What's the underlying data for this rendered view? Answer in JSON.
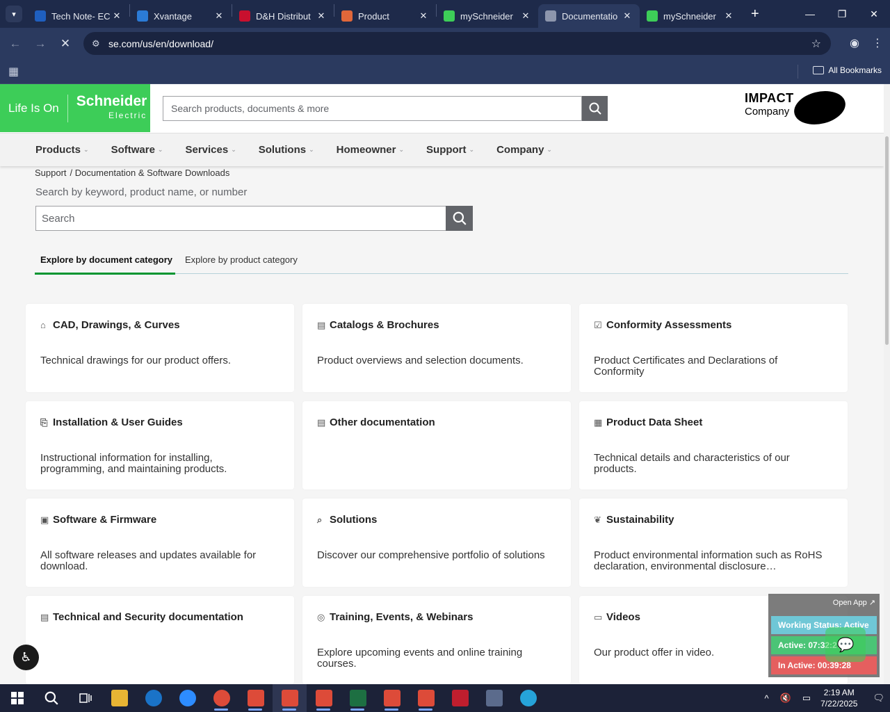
{
  "browser": {
    "tabs": [
      {
        "title": "Tech Note- EC",
        "icon": "ec-favicon",
        "color": "#1f5fbf",
        "active": false
      },
      {
        "title": "Xvantage",
        "icon": "xvantage-favicon",
        "color": "#2b7bd6",
        "active": false
      },
      {
        "title": "D&H Distribut",
        "icon": "dh-favicon",
        "color": "#c8102e",
        "active": false
      },
      {
        "title": "Product",
        "icon": "product-favicon",
        "color": "#e0673a",
        "active": false
      },
      {
        "title": "mySchneider",
        "icon": "schneider-favicon",
        "color": "#3dcd58",
        "active": false
      },
      {
        "title": "Documentatio",
        "icon": "loading-favicon",
        "color": "#8d96ad",
        "active": true
      },
      {
        "title": "mySchneider",
        "icon": "schneider-favicon",
        "color": "#3dcd58",
        "active": false
      }
    ],
    "url": "se.com/us/en/download/",
    "all_bookmarks": "All Bookmarks"
  },
  "site": {
    "logo_lifeison": "Life Is On",
    "logo_brand": "Schneider",
    "logo_sub": "Electric",
    "search_placeholder": "Search products, documents & more",
    "impact_line1": "IMPACT",
    "impact_line2": "Company",
    "nav": [
      "Products",
      "Software",
      "Services",
      "Solutions",
      "Homeowner",
      "Support",
      "Company"
    ]
  },
  "breadcrumb": [
    "Support",
    "/ Documentation & Software Downloads"
  ],
  "search_prompt": "Search by keyword, product name, or number",
  "search_placeholder": "Search",
  "tabs": {
    "document": "Explore by document category",
    "product": "Explore by product category"
  },
  "cards": [
    {
      "icon": "cad-icon",
      "title": "CAD, Drawings, & Curves",
      "desc": "Technical drawings for our product offers."
    },
    {
      "icon": "catalog-icon",
      "title": "Catalogs & Brochures",
      "desc": "Product overviews and selection documents."
    },
    {
      "icon": "conformity-icon",
      "title": "Conformity Assessments",
      "desc": "Product Certificates and Declarations of Conformity"
    },
    {
      "icon": "guide-icon",
      "title": "Installation & User Guides",
      "desc": "Instructional information for installing, programming, and maintaining products."
    },
    {
      "icon": "document-icon",
      "title": "Other documentation",
      "desc": ""
    },
    {
      "icon": "datasheet-icon",
      "title": "Product Data Sheet",
      "desc": "Technical details and characteristics of our products."
    },
    {
      "icon": "software-icon",
      "title": "Software & Firmware",
      "desc": "All software releases and updates available for download."
    },
    {
      "icon": "solutions-icon",
      "title": "Solutions",
      "desc": "Discover our comprehensive portfolio of solutions"
    },
    {
      "icon": "leaf-icon",
      "title": "Sustainability",
      "desc": "Product environmental information such as RoHS declaration, environmental disclosure…"
    },
    {
      "icon": "security-doc-icon",
      "title": "Technical and Security documentation",
      "desc": ""
    },
    {
      "icon": "training-icon",
      "title": "Training, Events, & Webinars",
      "desc": "Explore upcoming events and online training courses."
    },
    {
      "icon": "video-icon",
      "title": "Videos",
      "desc": "Our product offer in video."
    }
  ],
  "widget": {
    "open_app": "Open App ↗",
    "working_status": "Working Status: Active",
    "active": "Active: 07:32:27",
    "inactive": "In Active: 00:39:28"
  },
  "taskbar": {
    "time": "2:19 AM",
    "date": "7/22/2025",
    "apps": [
      {
        "name": "file-explorer-icon",
        "color": "#e8b534"
      },
      {
        "name": "outlook-icon",
        "color": "#1a73c8"
      },
      {
        "name": "zoom-icon",
        "color": "#2d8cff"
      },
      {
        "name": "chrome-icon",
        "color": "#dd4b39"
      },
      {
        "name": "chrome-profile-icon",
        "color": "#dd4b39"
      },
      {
        "name": "chrome-profile-icon",
        "color": "#dd4b39"
      },
      {
        "name": "chrome-profile-icon",
        "color": "#dd4b39"
      },
      {
        "name": "excel-icon",
        "color": "#1d6f42"
      },
      {
        "name": "chrome-profile-icon",
        "color": "#dd4b39"
      },
      {
        "name": "chrome-profile-icon",
        "color": "#dd4b39"
      },
      {
        "name": "filezilla-icon",
        "color": "#bf1e2e"
      },
      {
        "name": "calculator-icon",
        "color": "#5b6b8c"
      },
      {
        "name": "app-icon",
        "color": "#26a3d9"
      }
    ]
  }
}
